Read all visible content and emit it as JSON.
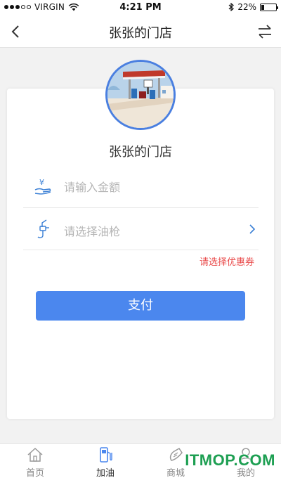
{
  "status_bar": {
    "carrier": "VIRGIN",
    "time": "4:21 PM",
    "battery": "22%",
    "battery_level": 0.22,
    "signal_bars_filled": 3,
    "signal_bars_total": 5
  },
  "nav": {
    "title": "张张的门店",
    "back_icon": "chevron-left-icon",
    "switch_icon": "swap-arrows-icon"
  },
  "store": {
    "name": "张张的门店",
    "avatar_icon": "gas-station-photo"
  },
  "form": {
    "amount_placeholder": "请输入金额",
    "amount_value": "",
    "amount_icon": "yuan-hand-icon",
    "nozzle_placeholder": "请选择油枪",
    "nozzle_icon": "fuel-nozzle-icon",
    "coupon_link": "请选择优惠券",
    "pay_button": "支付"
  },
  "colors": {
    "primary": "#4b87ee",
    "coupon_red": "#e94848",
    "avatar_ring": "#4a7fe0"
  },
  "tab_bar": {
    "tabs": [
      {
        "label": "首页",
        "icon": "home-icon",
        "active": false
      },
      {
        "label": "加油",
        "icon": "fuel-pump-icon",
        "active": true
      },
      {
        "label": "商城",
        "icon": "mall-icon",
        "active": false
      },
      {
        "label": "我的",
        "icon": "user-icon",
        "active": false
      }
    ]
  },
  "watermark": "ITMOP.COM"
}
